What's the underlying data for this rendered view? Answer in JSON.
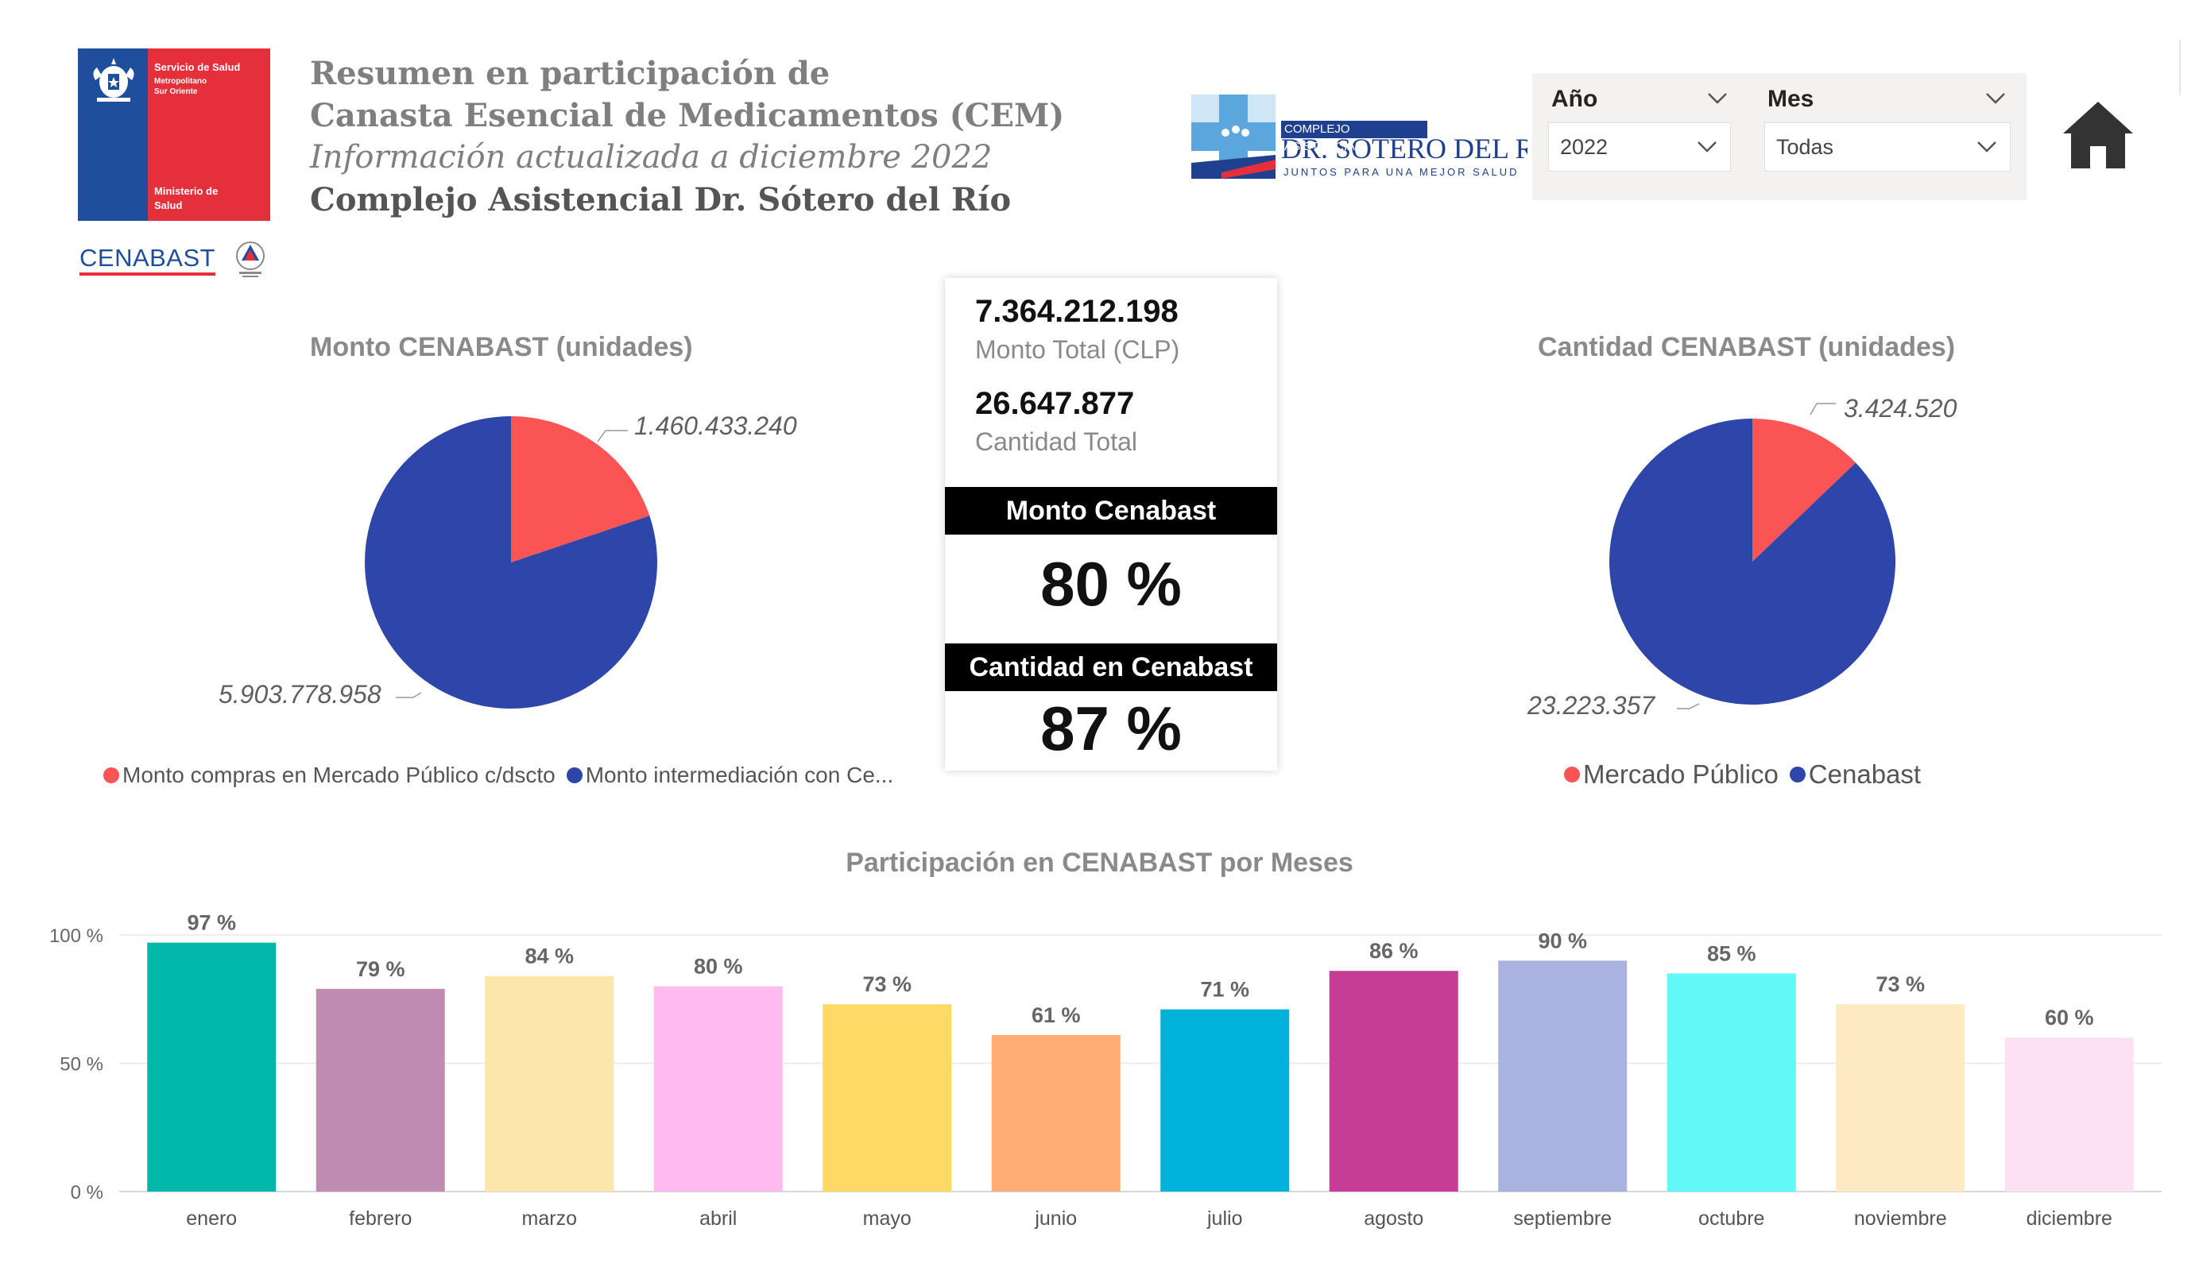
{
  "header": {
    "logo_ssmso": {
      "line1": "Servicio de Salud",
      "line2": "Metropolitano",
      "line3": "Sur Oriente",
      "line4": "Ministerio de",
      "line5": "Salud"
    },
    "logo_cenabast": "CENABAST",
    "title_line1": "Resumen en participación de",
    "title_line2": "Canasta Esencial de Medicamentos (CEM)",
    "title_line3": "Información actualizada a diciembre 2022",
    "title_line4": "Complejo Asistencial Dr. Sótero del Río",
    "logo_hospital": {
      "top": "COMPLEJO ASISTENCIAL",
      "name": "DR. SÓTERO DEL RÍO",
      "tagline": "JUNTOS PARA UNA MEJOR SALUD"
    }
  },
  "filters": {
    "year": {
      "label": "Año",
      "value": "2022"
    },
    "month": {
      "label": "Mes",
      "value": "Todas"
    }
  },
  "kpi": {
    "monto_total_value": "7.364.212.198",
    "monto_total_label": "Monto Total (CLP)",
    "cantidad_total_value": "26.647.877",
    "cantidad_total_label": "Cantidad Total",
    "monto_cenabast_label": "Monto Cenabast",
    "monto_cenabast_pct": "80 %",
    "cantidad_cenabast_label": "Cantidad en Cenabast",
    "cantidad_cenabast_pct": "87 %"
  },
  "colors": {
    "red": "#fa5454",
    "blue": "#2e45aa",
    "accent_blue": "#1f4e9c",
    "accent_red": "#e52f3a"
  },
  "chart_data": [
    {
      "type": "pie",
      "title": "Monto CENABAST (unidades)",
      "series": [
        {
          "name": "Monto compras en Mercado Público c/dscto",
          "value": 1460433240,
          "label": "1.460.433.240",
          "color": "#fa5454"
        },
        {
          "name": "Monto intermediación con Ce...",
          "value": 5903778958,
          "label": "5.903.778.958",
          "color": "#2e45aa"
        }
      ]
    },
    {
      "type": "pie",
      "title": "Cantidad CENABAST (unidades)",
      "series": [
        {
          "name": "Mercado Público",
          "value": 3424520,
          "label": "3.424.520",
          "color": "#fa5454"
        },
        {
          "name": "Cenabast",
          "value": 23223357,
          "label": "23.223.357",
          "color": "#2e45aa"
        }
      ]
    },
    {
      "type": "bar",
      "title": "Participación en CENABAST por Meses",
      "categories": [
        "enero",
        "febrero",
        "marzo",
        "abril",
        "mayo",
        "junio",
        "julio",
        "agosto",
        "septiembre",
        "octubre",
        "noviembre",
        "diciembre"
      ],
      "values": [
        97,
        79,
        84,
        80,
        73,
        61,
        71,
        86,
        90,
        85,
        73,
        60
      ],
      "labels": [
        "97 %",
        "79 %",
        "84 %",
        "80 %",
        "73 %",
        "61 %",
        "71 %",
        "86 %",
        "90 %",
        "85 %",
        "73 %",
        "60 %"
      ],
      "colors": [
        "#01b8aa",
        "#c08bb0",
        "#fde6a9",
        "#ffbbef",
        "#fed966",
        "#ffad74",
        "#00b1da",
        "#c63d96",
        "#aab3e0",
        "#61f9f8",
        "#fdeac3",
        "#fde0f4"
      ],
      "yticks": [
        "0 %",
        "50 %",
        "100 %"
      ],
      "ylim": [
        0,
        100
      ],
      "grid": true
    }
  ]
}
